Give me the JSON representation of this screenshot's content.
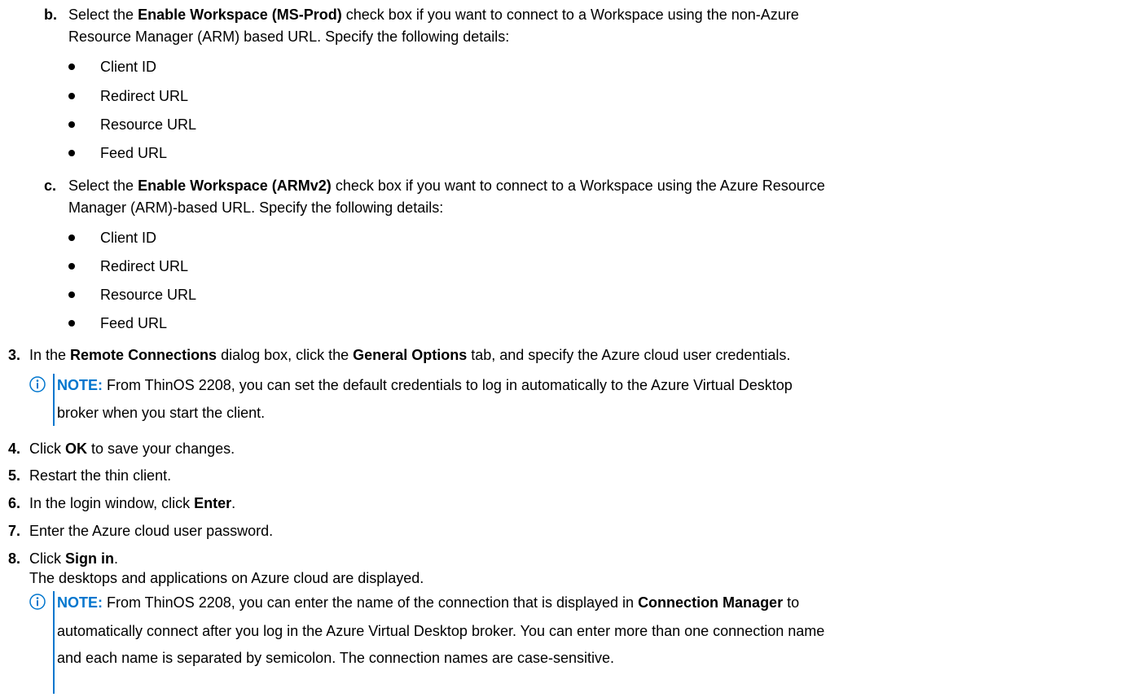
{
  "colors": {
    "text": "#000000",
    "note_accent": "#0076ce",
    "background": "#ffffff"
  },
  "step_b": {
    "marker": "b.",
    "pre": "Select the ",
    "bold": "Enable Workspace (MS-Prod)",
    "post": " check box if you want to connect to a Workspace using the non-Azure",
    "line2": "Resource Manager (ARM) based URL. Specify the following details:",
    "items": [
      "Client ID",
      "Redirect URL",
      "Resource URL",
      "Feed URL"
    ]
  },
  "step_c": {
    "marker": "c.",
    "pre": "Select the ",
    "bold": "Enable Workspace (ARMv2)",
    "post": " check box if you want to connect to a Workspace using the Azure Resource",
    "line2": "Manager (ARM)-based URL. Specify the following details:",
    "items": [
      "Client ID",
      "Redirect URL",
      "Resource URL",
      "Feed URL"
    ]
  },
  "step_3": {
    "marker": "3.",
    "t1": "In the ",
    "b1": "Remote Connections",
    "t2": " dialog box, click the ",
    "b2": "General Options",
    "t3": " tab, and specify the Azure cloud user credentials."
  },
  "note_1": {
    "icon": "info-icon",
    "label": "NOTE:",
    "line1": " From ThinOS 2208, you can set the default credentials to log in automatically to the Azure Virtual Desktop",
    "line2": "broker when you start the client."
  },
  "step_4": {
    "marker": "4.",
    "t1": "Click ",
    "b1": "OK",
    "t2": " to save your changes."
  },
  "step_5": {
    "marker": "5.",
    "text": "Restart the thin client."
  },
  "step_6": {
    "marker": "6.",
    "t1": "In the login window, click ",
    "b1": "Enter",
    "t2": "."
  },
  "step_7": {
    "marker": "7.",
    "text": "Enter the Azure cloud user password."
  },
  "step_8": {
    "marker": "8.",
    "t1": "Click ",
    "b1": "Sign in",
    "t2": ".",
    "result": "The desktops and applications on Azure cloud are displayed."
  },
  "note_2": {
    "icon": "info-icon",
    "label": "NOTE:",
    "line1_a": " From ThinOS 2208, you can enter the name of the connection that is displayed in ",
    "line1_b": "Connection Manager",
    "line1_c": " to",
    "line2": "automatically connect after you log in the Azure Virtual Desktop broker. You can enter more than one connection name",
    "line3": "and each name is separated by semicolon. The connection names are case-sensitive."
  }
}
